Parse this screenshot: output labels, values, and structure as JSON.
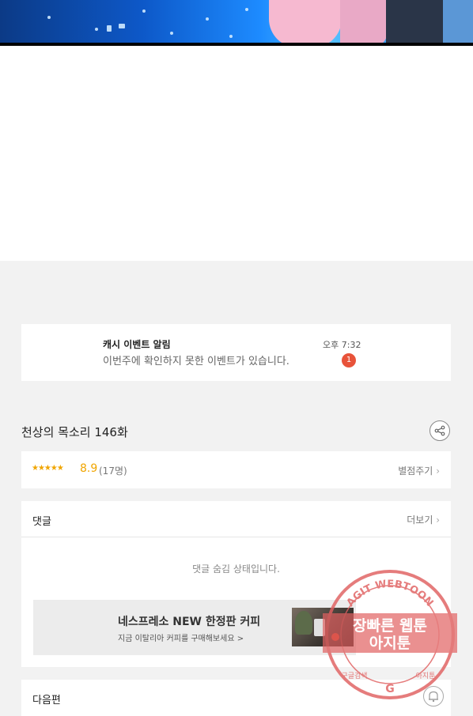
{
  "notification": {
    "title": "캐시 이벤트 알림",
    "message": "이번주에 확인하지 못한 이벤트가 있습니다.",
    "time": "오후 7:32",
    "badge": "1"
  },
  "episode": {
    "title": "천상의 목소리 146화"
  },
  "rating": {
    "stars": "★★★★★",
    "score": "8.9",
    "count": "(17명)",
    "rate_label": "별점주기"
  },
  "comments": {
    "title": "댓글",
    "more_label": "더보기",
    "hidden_message": "댓글 숨김 상태입니다."
  },
  "ad": {
    "title": "네스프레소 NEW 한정판 커피",
    "subtitle": "지금 이탈리아 커피를 구매해보세요 >"
  },
  "next_episode": {
    "label": "다음편"
  },
  "watermark": {
    "top_text": "AGIT WEBTOON",
    "line1": "장빠른 웹툰",
    "line2": "아지툰",
    "left_text": "구글검색",
    "right_text": "아지툰",
    "logo": "G"
  },
  "icons": {
    "share": "share-icon",
    "bell": "bell-icon",
    "chevron": "chevron-right-icon"
  },
  "colors": {
    "accent_star": "#f0a500",
    "badge": "#e8533a",
    "stamp": "#e06060"
  }
}
